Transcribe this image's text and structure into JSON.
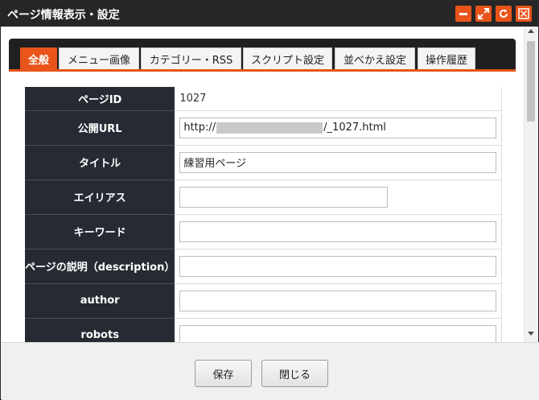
{
  "window": {
    "title": "ページ情報表示・設定",
    "accent_color": "#e8541a",
    "controls": [
      {
        "name": "minimize-icon"
      },
      {
        "name": "maximize-icon"
      },
      {
        "name": "refresh-icon"
      },
      {
        "name": "close-icon"
      }
    ]
  },
  "tabs": [
    {
      "label": "全般",
      "active": true
    },
    {
      "label": "メニュー画像",
      "active": false
    },
    {
      "label": "カテゴリー・RSS",
      "active": false
    },
    {
      "label": "スクリプト設定",
      "active": false
    },
    {
      "label": "並べかえ設定",
      "active": false
    },
    {
      "label": "操作履歴",
      "active": false
    }
  ],
  "form": {
    "page_id": {
      "label": "ページID",
      "value": "1027"
    },
    "url": {
      "label": "公開URL",
      "prefix": "http://",
      "suffix": "/_1027.html"
    },
    "title": {
      "label": "タイトル",
      "value": "練習用ページ"
    },
    "alias": {
      "label": "エイリアス",
      "value": ""
    },
    "keywords": {
      "label": "キーワード",
      "value": ""
    },
    "description": {
      "label": "ページの説明（description）",
      "value": ""
    },
    "author": {
      "label": "author",
      "value": ""
    },
    "robots": {
      "label": "robots",
      "value": ""
    }
  },
  "footer": {
    "save_label": "保存",
    "close_label": "閉じる"
  }
}
